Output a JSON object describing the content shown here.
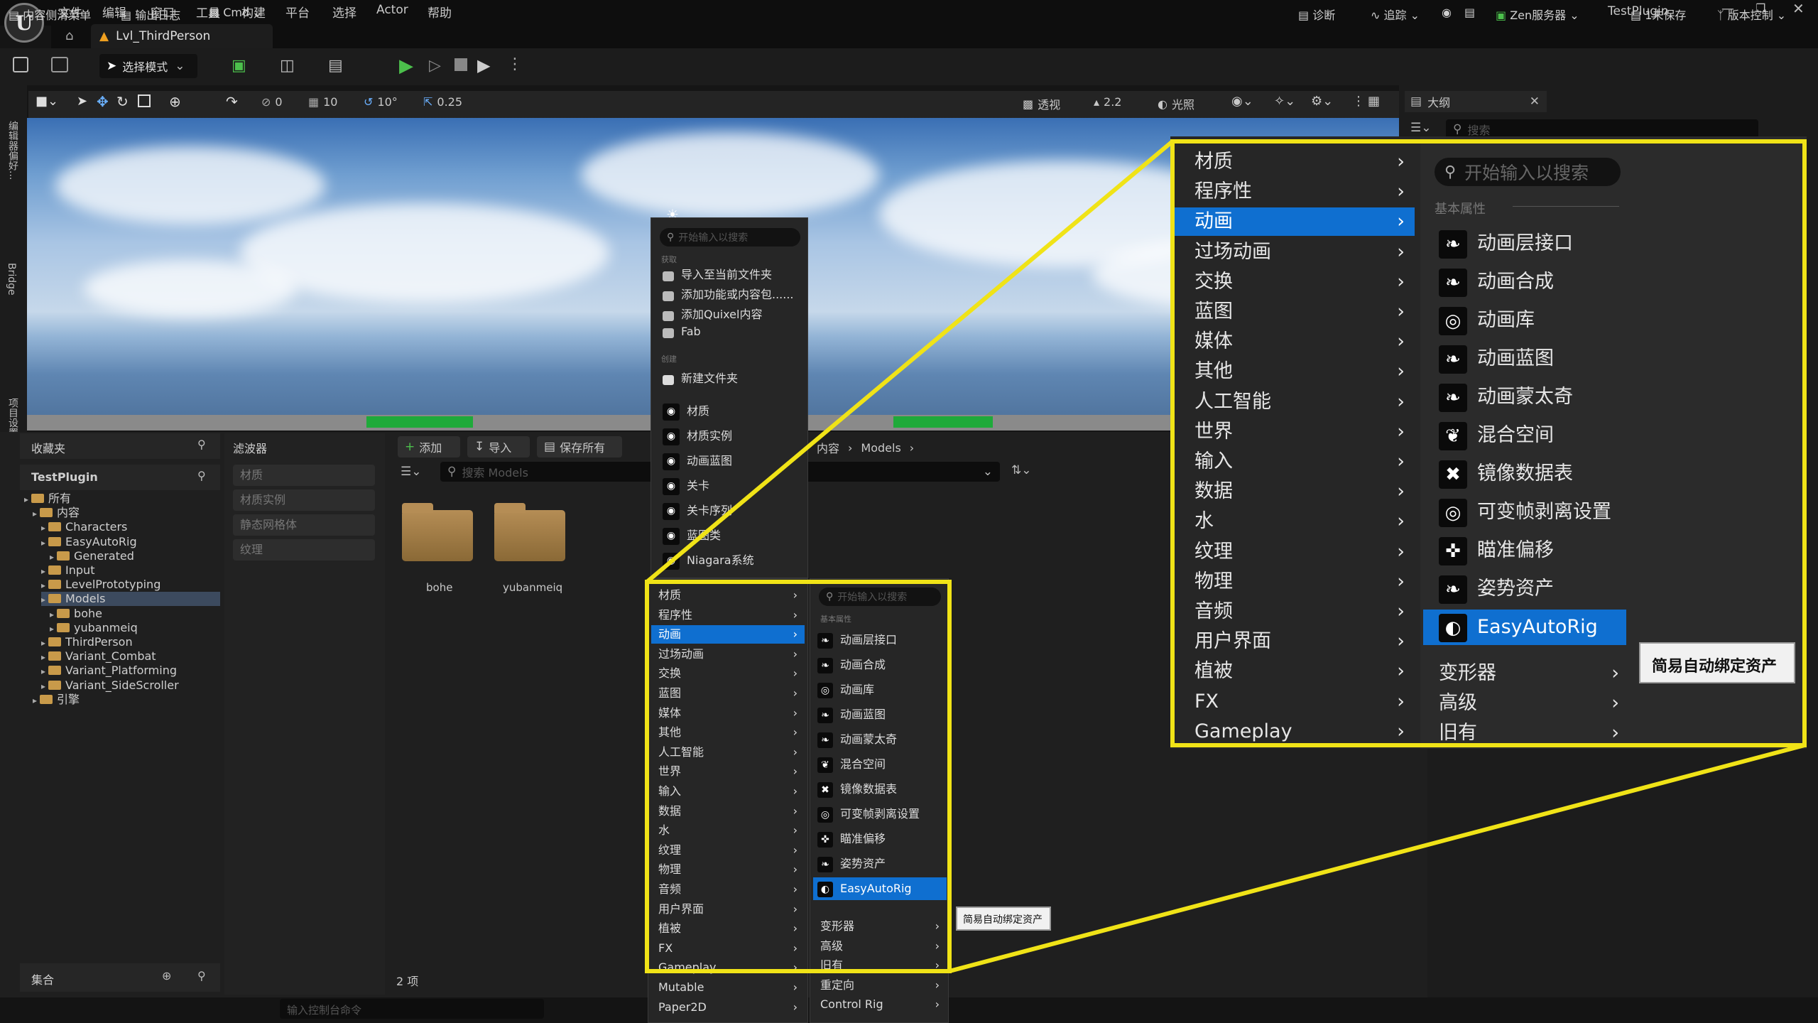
{
  "app": {
    "project": "TestPlugin",
    "level_tab": "Lvl_ThirdPerson",
    "logo_text": "U"
  },
  "menu": [
    "文件",
    "编辑",
    "窗口",
    "工具",
    "构建",
    "平台",
    "选择",
    "Actor",
    "帮助"
  ],
  "toolbar": {
    "select_mode": "选择模式"
  },
  "viewport_toolbar": {
    "snap_angle": "0",
    "grid": "10",
    "rotation": "10°",
    "scale": "0.25",
    "view": "透视",
    "fov": "2.2",
    "light": "光照"
  },
  "left_sidebar": {
    "details": "编辑器偏好...",
    "bridge": "Bridge",
    "project_settings": "项目设置"
  },
  "outliner": {
    "title": "大纲",
    "search_placeholder": "搜索"
  },
  "content_browser": {
    "favorites": "收藏夹",
    "project": "TestPlugin",
    "filters": "滤波器",
    "add": "添加",
    "import": "导入",
    "save_all": "保存所有",
    "breadcrumb": [
      "内容",
      "Models"
    ],
    "search_placeholder": "搜索 Models",
    "filter_items": [
      "材质",
      "材质实例",
      "静态网格体",
      "纹理"
    ],
    "tree": [
      {
        "label": "所有",
        "indent": 0
      },
      {
        "label": "内容",
        "indent": 1
      },
      {
        "label": "Characters",
        "indent": 2
      },
      {
        "label": "EasyAutoRig",
        "indent": 2
      },
      {
        "label": "Generated",
        "indent": 3
      },
      {
        "label": "Input",
        "indent": 2
      },
      {
        "label": "LevelPrototyping",
        "indent": 2
      },
      {
        "label": "Models",
        "indent": 2,
        "selected": true
      },
      {
        "label": "bohe",
        "indent": 3
      },
      {
        "label": "yubanmeiq",
        "indent": 3
      },
      {
        "label": "ThirdPerson",
        "indent": 2
      },
      {
        "label": "Variant_Combat",
        "indent": 2
      },
      {
        "label": "Variant_Platforming",
        "indent": 2
      },
      {
        "label": "Variant_SideScroller",
        "indent": 2
      },
      {
        "label": "引擎",
        "indent": 1
      }
    ],
    "folders": [
      "bohe",
      "yubanmeiq"
    ],
    "item_count": "2 项",
    "collections": "集合"
  },
  "context_menu": {
    "search_placeholder": "开始输入以搜索",
    "section_get": "获取",
    "get_items": [
      "导入至当前文件夹",
      "添加功能或内容包......",
      "添加Quixel内容",
      "Fab"
    ],
    "section_create": "创建",
    "new_folder": "新建文件夹",
    "assets": [
      "材质",
      "材质实例",
      "动画蓝图",
      "关卡",
      "关卡序列",
      "蓝图类",
      "Niagara系统"
    ],
    "categories": [
      "材质",
      "程序性",
      "动画",
      "过场动画",
      "交换",
      "蓝图",
      "媒体",
      "其他",
      "人工智能",
      "世界",
      "输入",
      "数据",
      "水",
      "纹理",
      "物理",
      "音频",
      "用户界面",
      "植被",
      "FX",
      "Gameplay",
      "Mutable",
      "Paper2D"
    ],
    "selected_category": "动画"
  },
  "submenu": {
    "search_placeholder": "开始输入以搜索",
    "section": "基本属性",
    "items": [
      "动画层接口",
      "动画合成",
      "动画库",
      "动画蓝图",
      "动画蒙太奇",
      "混合空间",
      "镜像数据表",
      "可变帧剥离设置",
      "瞄准偏移",
      "姿势资产",
      "EasyAutoRig"
    ],
    "selected": "EasyAutoRig",
    "more": [
      "变形器",
      "高级",
      "旧有",
      "重定向",
      "Control Rig"
    ],
    "tooltip": "简易自动绑定资产"
  },
  "statusbar": {
    "drawer": "内容侧滑菜单",
    "output_log": "输出日志",
    "cmd": "Cmd",
    "cmd_placeholder": "输入控制台命令",
    "diagnostics": "诊断",
    "trace": "追踪",
    "zen": "Zen服务器",
    "unsaved": "1未保存",
    "source_control": "版本控制"
  },
  "colors": {
    "highlight": "#f0e317",
    "selection": "#0f6fd0",
    "panel": "#262626"
  }
}
